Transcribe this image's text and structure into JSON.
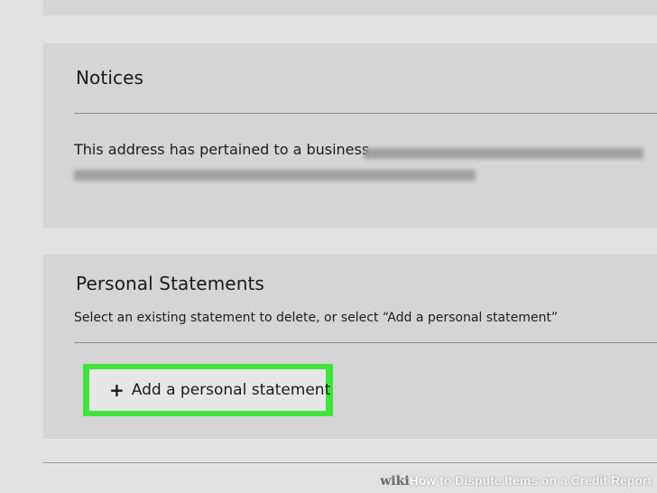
{
  "notices": {
    "title": "Notices",
    "text": "This address has pertained to a business"
  },
  "personal_statements": {
    "title": "Personal Statements",
    "instructions": "Select an existing statement to delete, or select “Add a personal statement”",
    "add_button_label": "Add a personal statement",
    "highlight_color": "#3ee43a"
  },
  "icons": {
    "add": "plus-icon"
  },
  "watermark": {
    "brand": "wiki",
    "how": "How",
    "title": " to Dispute Items on a Credit Report"
  }
}
